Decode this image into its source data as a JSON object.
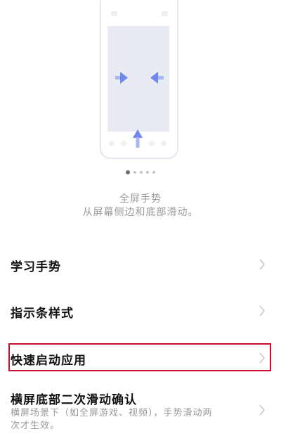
{
  "illustration": {
    "icon": "gesture-phone-illustration"
  },
  "pager": {
    "count": 5,
    "active": 0
  },
  "caption": {
    "title": "全屏手势",
    "subtitle": "从屏幕侧边和底部滑动。"
  },
  "settings": {
    "items": [
      {
        "label": "学习手势"
      },
      {
        "label": "指示条样式"
      },
      {
        "label": "快速启动应用"
      },
      {
        "label": "横屏底部二次滑动确认",
        "description": "横屏场景下（如全屏游戏、视频），手势滑动两次才生效。"
      }
    ]
  },
  "colors": {
    "highlight": "#c8102e",
    "illustration_blue": "#6f87ee"
  }
}
